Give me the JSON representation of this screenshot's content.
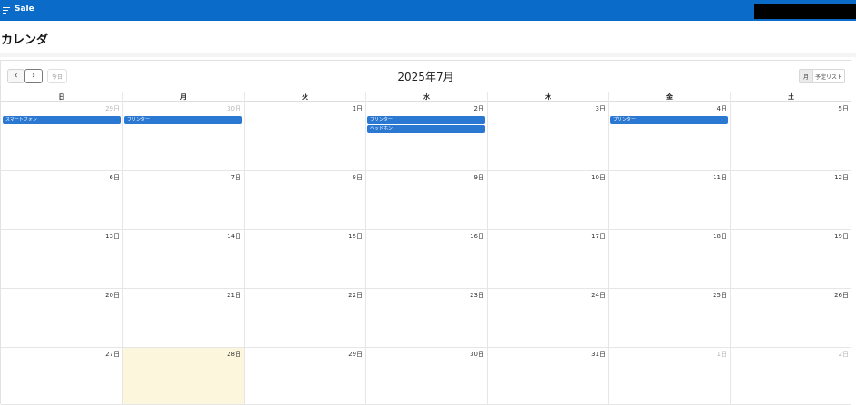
{
  "header": {
    "app_title": "Sale",
    "menu_icon": "hamburger-menu-icon",
    "brand_color": "#0b6bc8"
  },
  "page": {
    "title": "カレンダ"
  },
  "calendar": {
    "month_title": "2025年7月",
    "toolbar": {
      "prev_icon": "chevron-left-icon",
      "next_icon": "chevron-right-icon",
      "prev_glyph": "‹",
      "next_glyph": "›",
      "today_label": "今日"
    },
    "views": {
      "month_label": "月",
      "list_label": "予定リスト"
    },
    "weekdays": [
      "日",
      "月",
      "火",
      "水",
      "木",
      "金",
      "土"
    ],
    "weeks": [
      [
        {
          "label": "29日",
          "other": true
        },
        {
          "label": "30日",
          "other": true
        },
        {
          "label": "1日"
        },
        {
          "label": "2日"
        },
        {
          "label": "3日"
        },
        {
          "label": "4日"
        },
        {
          "label": "5日"
        }
      ],
      [
        {
          "label": "6日"
        },
        {
          "label": "7日"
        },
        {
          "label": "8日"
        },
        {
          "label": "9日"
        },
        {
          "label": "10日"
        },
        {
          "label": "11日"
        },
        {
          "label": "12日"
        }
      ],
      [
        {
          "label": "13日"
        },
        {
          "label": "14日"
        },
        {
          "label": "15日"
        },
        {
          "label": "16日"
        },
        {
          "label": "17日"
        },
        {
          "label": "18日"
        },
        {
          "label": "19日"
        }
      ],
      [
        {
          "label": "20日"
        },
        {
          "label": "21日"
        },
        {
          "label": "22日"
        },
        {
          "label": "23日"
        },
        {
          "label": "24日"
        },
        {
          "label": "25日"
        },
        {
          "label": "26日"
        }
      ],
      [
        {
          "label": "27日"
        },
        {
          "label": "28日",
          "today": true
        },
        {
          "label": "29日"
        },
        {
          "label": "30日"
        },
        {
          "label": "31日"
        },
        {
          "label": "1日",
          "other": true
        },
        {
          "label": "2日",
          "other": true
        }
      ]
    ],
    "events": [
      {
        "title": "スマートフォン",
        "week": 0,
        "day": 0,
        "slot": 0
      },
      {
        "title": "プリンター",
        "week": 0,
        "day": 1,
        "slot": 0
      },
      {
        "title": "プリンター",
        "week": 0,
        "day": 3,
        "slot": 0
      },
      {
        "title": "ヘッドホン",
        "week": 0,
        "day": 3,
        "slot": 1
      },
      {
        "title": "プリンター",
        "week": 0,
        "day": 5,
        "slot": 0
      }
    ],
    "colors": {
      "event": "#2a78d2",
      "today_bg": "#fcf6dc"
    }
  }
}
